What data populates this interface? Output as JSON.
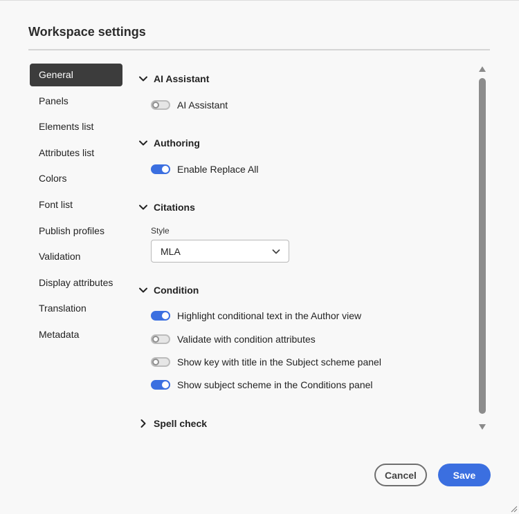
{
  "dialog": {
    "title": "Workspace settings"
  },
  "sidebar": {
    "items": [
      {
        "label": "General",
        "selected": true
      },
      {
        "label": "Panels"
      },
      {
        "label": "Elements list"
      },
      {
        "label": "Attributes list"
      },
      {
        "label": "Colors"
      },
      {
        "label": "Font list"
      },
      {
        "label": "Publish profiles"
      },
      {
        "label": "Validation"
      },
      {
        "label": "Display attributes"
      },
      {
        "label": "Translation"
      },
      {
        "label": "Metadata"
      }
    ]
  },
  "sections": {
    "ai_assistant": {
      "title": "AI Assistant",
      "expanded": true,
      "toggles": [
        {
          "label": "AI Assistant",
          "on": false
        }
      ]
    },
    "authoring": {
      "title": "Authoring",
      "expanded": true,
      "toggles": [
        {
          "label": "Enable Replace All",
          "on": true
        }
      ]
    },
    "citations": {
      "title": "Citations",
      "expanded": true,
      "style_label": "Style",
      "style_value": "MLA"
    },
    "condition": {
      "title": "Condition",
      "expanded": true,
      "toggles": [
        {
          "label": "Highlight conditional text in the Author view",
          "on": true
        },
        {
          "label": "Validate with condition attributes",
          "on": false
        },
        {
          "label": "Show key with title in the Subject scheme panel",
          "on": false
        },
        {
          "label": "Show subject scheme in the Conditions panel",
          "on": true
        }
      ]
    },
    "spell_check": {
      "title": "Spell check",
      "expanded": false
    }
  },
  "footer": {
    "cancel_label": "Cancel",
    "save_label": "Save"
  },
  "colors": {
    "accent": "#3b6fe0",
    "selected_nav": "#3c3c3c"
  }
}
